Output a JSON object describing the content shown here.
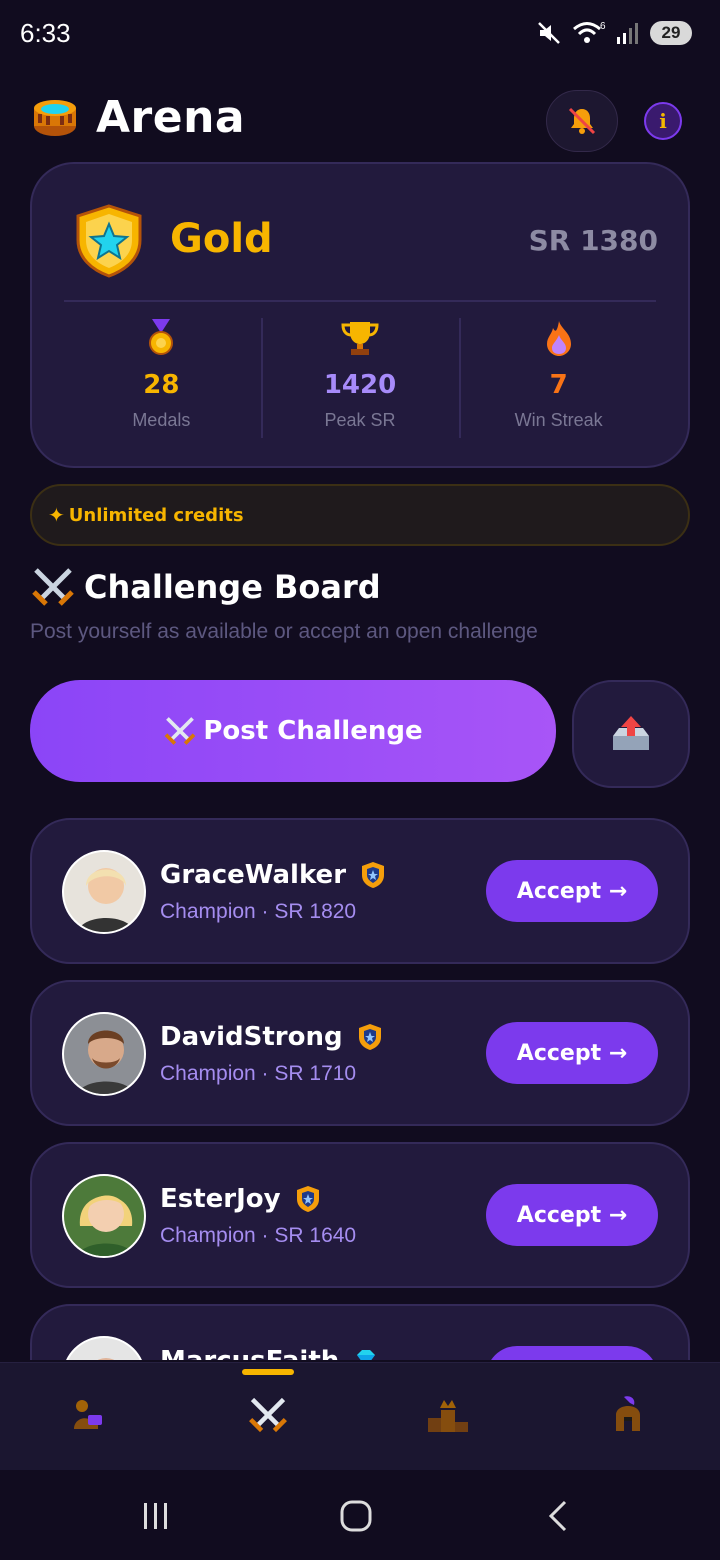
{
  "status": {
    "time": "6:33",
    "battery": "29"
  },
  "header": {
    "title": "Arena"
  },
  "rank": {
    "tier": "Gold",
    "sr": "SR 1380",
    "stats": [
      {
        "value": "28",
        "label": "Medals",
        "color": "#f7b500"
      },
      {
        "value": "1420",
        "label": "Peak SR",
        "color": "#a78bfa"
      },
      {
        "value": "7",
        "label": "Win Streak",
        "color": "#f97316"
      }
    ]
  },
  "credits": {
    "label": "Unlimited credits"
  },
  "board": {
    "title": "Challenge Board",
    "subtitle": "Post yourself as available or accept an open challenge",
    "post_label": "Post Challenge"
  },
  "challenges": [
    {
      "name": "GraceWalker",
      "meta": "Champion · SR 1820",
      "action": "Accept →"
    },
    {
      "name": "DavidStrong",
      "meta": "Champion · SR 1710",
      "action": "Accept →"
    },
    {
      "name": "EsterJoy",
      "meta": "Champion · SR 1640",
      "action": "Accept →"
    },
    {
      "name": "MarcusFaith",
      "meta": "",
      "action": ""
    }
  ],
  "nav": {
    "active_index": 1
  },
  "colors": {
    "accent": "#7c3aed",
    "gold": "#f7b500",
    "card": "#221a3d",
    "background": "#110c1f"
  }
}
